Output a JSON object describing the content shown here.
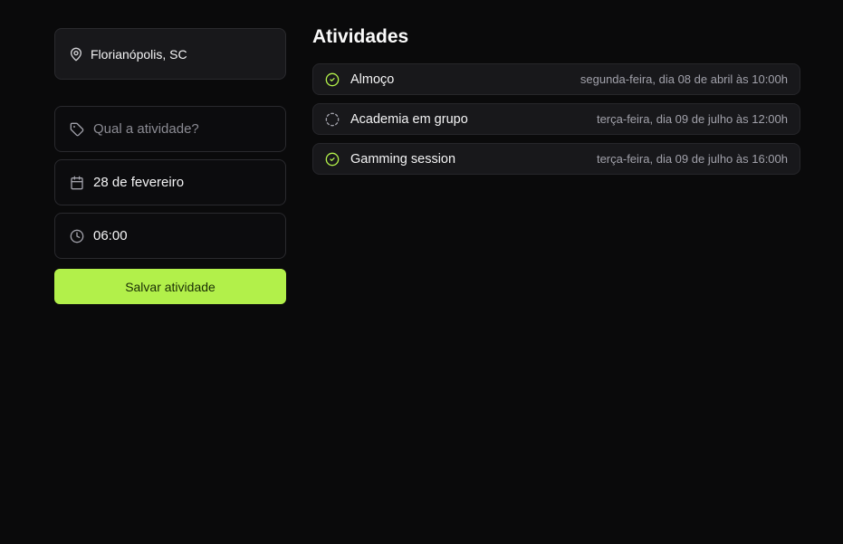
{
  "location": {
    "icon": "map-pin-icon",
    "text": "Florianópolis, SC"
  },
  "form": {
    "activity": {
      "icon": "tag-icon",
      "placeholder": "Qual a atividade?",
      "value": ""
    },
    "date": {
      "icon": "calendar-icon",
      "value": "28 de fevereiro"
    },
    "time": {
      "icon": "clock-icon",
      "value": "06:00"
    },
    "save_label": "Salvar atividade"
  },
  "main": {
    "title": "Atividades",
    "activities": [
      {
        "name": "Almoço",
        "date": "segunda-feira, dia 08 de abril às 10:00h",
        "status": "done",
        "icon": "circle-check-icon"
      },
      {
        "name": "Academia em grupo",
        "date": "terça-feira, dia 09 de julho às 12:00h",
        "status": "pending",
        "icon": "circle-dashed-icon"
      },
      {
        "name": "Gamming session",
        "date": "terça-feira, dia 09 de julho às 16:00h",
        "status": "done",
        "icon": "circle-check-icon"
      }
    ]
  },
  "colors": {
    "accent": "#b2f04a",
    "background": "#0a0a0b",
    "card": "#18181b",
    "muted_text": "#a1a1aa"
  }
}
